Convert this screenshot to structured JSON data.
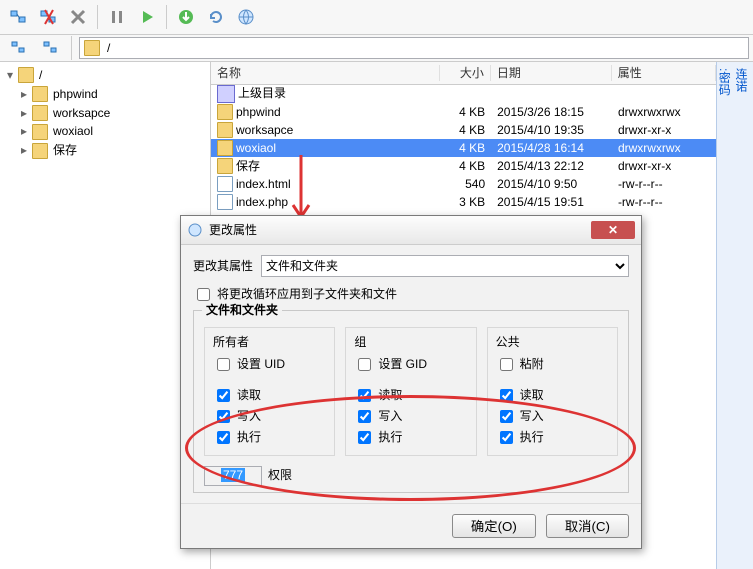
{
  "toolbar": {
    "path": "/",
    "buttons": [
      "connect",
      "disconnect",
      "stop",
      "pause",
      "play",
      "refresh",
      "download",
      "reload",
      "globe",
      "link1",
      "link2"
    ]
  },
  "rightPanel": {
    "labels": [
      "连诺",
      ":密码"
    ]
  },
  "tree": {
    "root": "/",
    "items": [
      "phpwind",
      "worksapce",
      "woxiaol",
      "保存"
    ]
  },
  "list": {
    "headers": {
      "name": "名称",
      "size": "大小",
      "date": "日期",
      "perm": "属性"
    },
    "up": "上级目录",
    "rows": [
      {
        "name": "phpwind",
        "size": "4 KB",
        "date": "2015/3/26 18:15",
        "perm": "drwxrwxrwx",
        "type": "folder"
      },
      {
        "name": "worksapce",
        "size": "4 KB",
        "date": "2015/4/10 19:35",
        "perm": "drwxr-xr-x",
        "type": "folder"
      },
      {
        "name": "woxiaol",
        "size": "4 KB",
        "date": "2015/4/28 16:14",
        "perm": "drwxrwxrwx",
        "type": "folder",
        "selected": true
      },
      {
        "name": "保存",
        "size": "4 KB",
        "date": "2015/4/13 22:12",
        "perm": "drwxr-xr-x",
        "type": "folder"
      },
      {
        "name": "index.html",
        "size": "540",
        "date": "2015/4/10 9:50",
        "perm": "-rw-r--r--",
        "type": "file"
      },
      {
        "name": "index.php",
        "size": "3 KB",
        "date": "2015/4/15 19:51",
        "perm": "-rw-r--r--",
        "type": "file"
      }
    ]
  },
  "dialog": {
    "title": "更改属性",
    "changeTarget": "更改其属性",
    "targetOption": "文件和文件夹",
    "recurseLabel": "将更改循环应用到子文件夹和文件",
    "groupTitle": "文件和文件夹",
    "owner": "所有者",
    "group": "组",
    "public": "公共",
    "setUID": "设置 UID",
    "setGID": "设置 GID",
    "sticky": "粘附",
    "read": "读取",
    "write": "写入",
    "exec": "执行",
    "permValue": "777",
    "permLabel": "权限",
    "ok": "确定(O)",
    "cancel": "取消(C)",
    "checks": {
      "owner": {
        "r": true,
        "w": true,
        "x": true,
        "s": false
      },
      "group": {
        "r": true,
        "w": true,
        "x": true,
        "s": false
      },
      "public": {
        "r": true,
        "w": true,
        "x": true,
        "s": false
      }
    }
  }
}
